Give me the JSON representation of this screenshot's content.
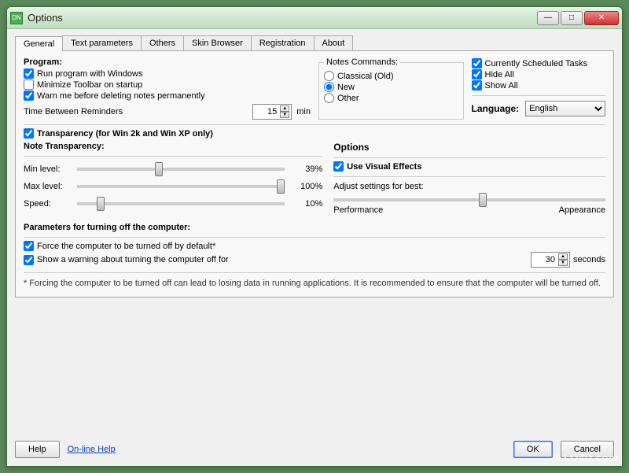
{
  "window": {
    "title": "Options",
    "icon_text": "DN"
  },
  "tabs": [
    "General",
    "Text parameters",
    "Others",
    "Skin Browser",
    "Registration",
    "About"
  ],
  "program": {
    "title": "Program:",
    "run_with_windows": "Run program with Windows",
    "minimize_toolbar": "Minimize Toolbar on startup",
    "warn_delete": "Warn me before deleting notes permanently",
    "time_between_label": "Time Between Reminders",
    "time_between_value": "15",
    "time_between_unit": "min"
  },
  "notes_commands": {
    "legend": "Notes Commands:",
    "classical": "Classical (Old)",
    "new": "New",
    "other": "Other"
  },
  "tasks": {
    "current": "Currently Scheduled Tasks",
    "hide_all": "Hide All",
    "show_all": "Show All"
  },
  "language": {
    "label": "Language:",
    "value": "English"
  },
  "transparency": {
    "checkbox": "Transparency (for Win 2k and Win XP only)",
    "title": "Note Transparency:",
    "min_label": "Min level:",
    "min_pct": "39%",
    "max_label": "Max level:",
    "max_pct": "100%",
    "speed_label": "Speed:",
    "speed_pct": "10%"
  },
  "options": {
    "title": "Options",
    "use_visual": "Use Visual Effects",
    "adjust_label": "Adjust settings for best:",
    "perf": "Performance",
    "appear": "Appearance"
  },
  "shutdown": {
    "title": "Parameters for turning off the computer:",
    "force": "Force the computer to be turned off by default*",
    "warn": "Show a warning about turning the computer off for",
    "seconds_value": "30",
    "seconds_unit": "seconds",
    "footnote": "* Forcing the computer to be turned off can lead to losing data in running applications. It is recommended to ensure that the computer will be turned off."
  },
  "buttons": {
    "help": "Help",
    "online": "On-line Help",
    "ok": "OK",
    "cancel": "Cancel"
  },
  "watermark": "© LO4D.com"
}
